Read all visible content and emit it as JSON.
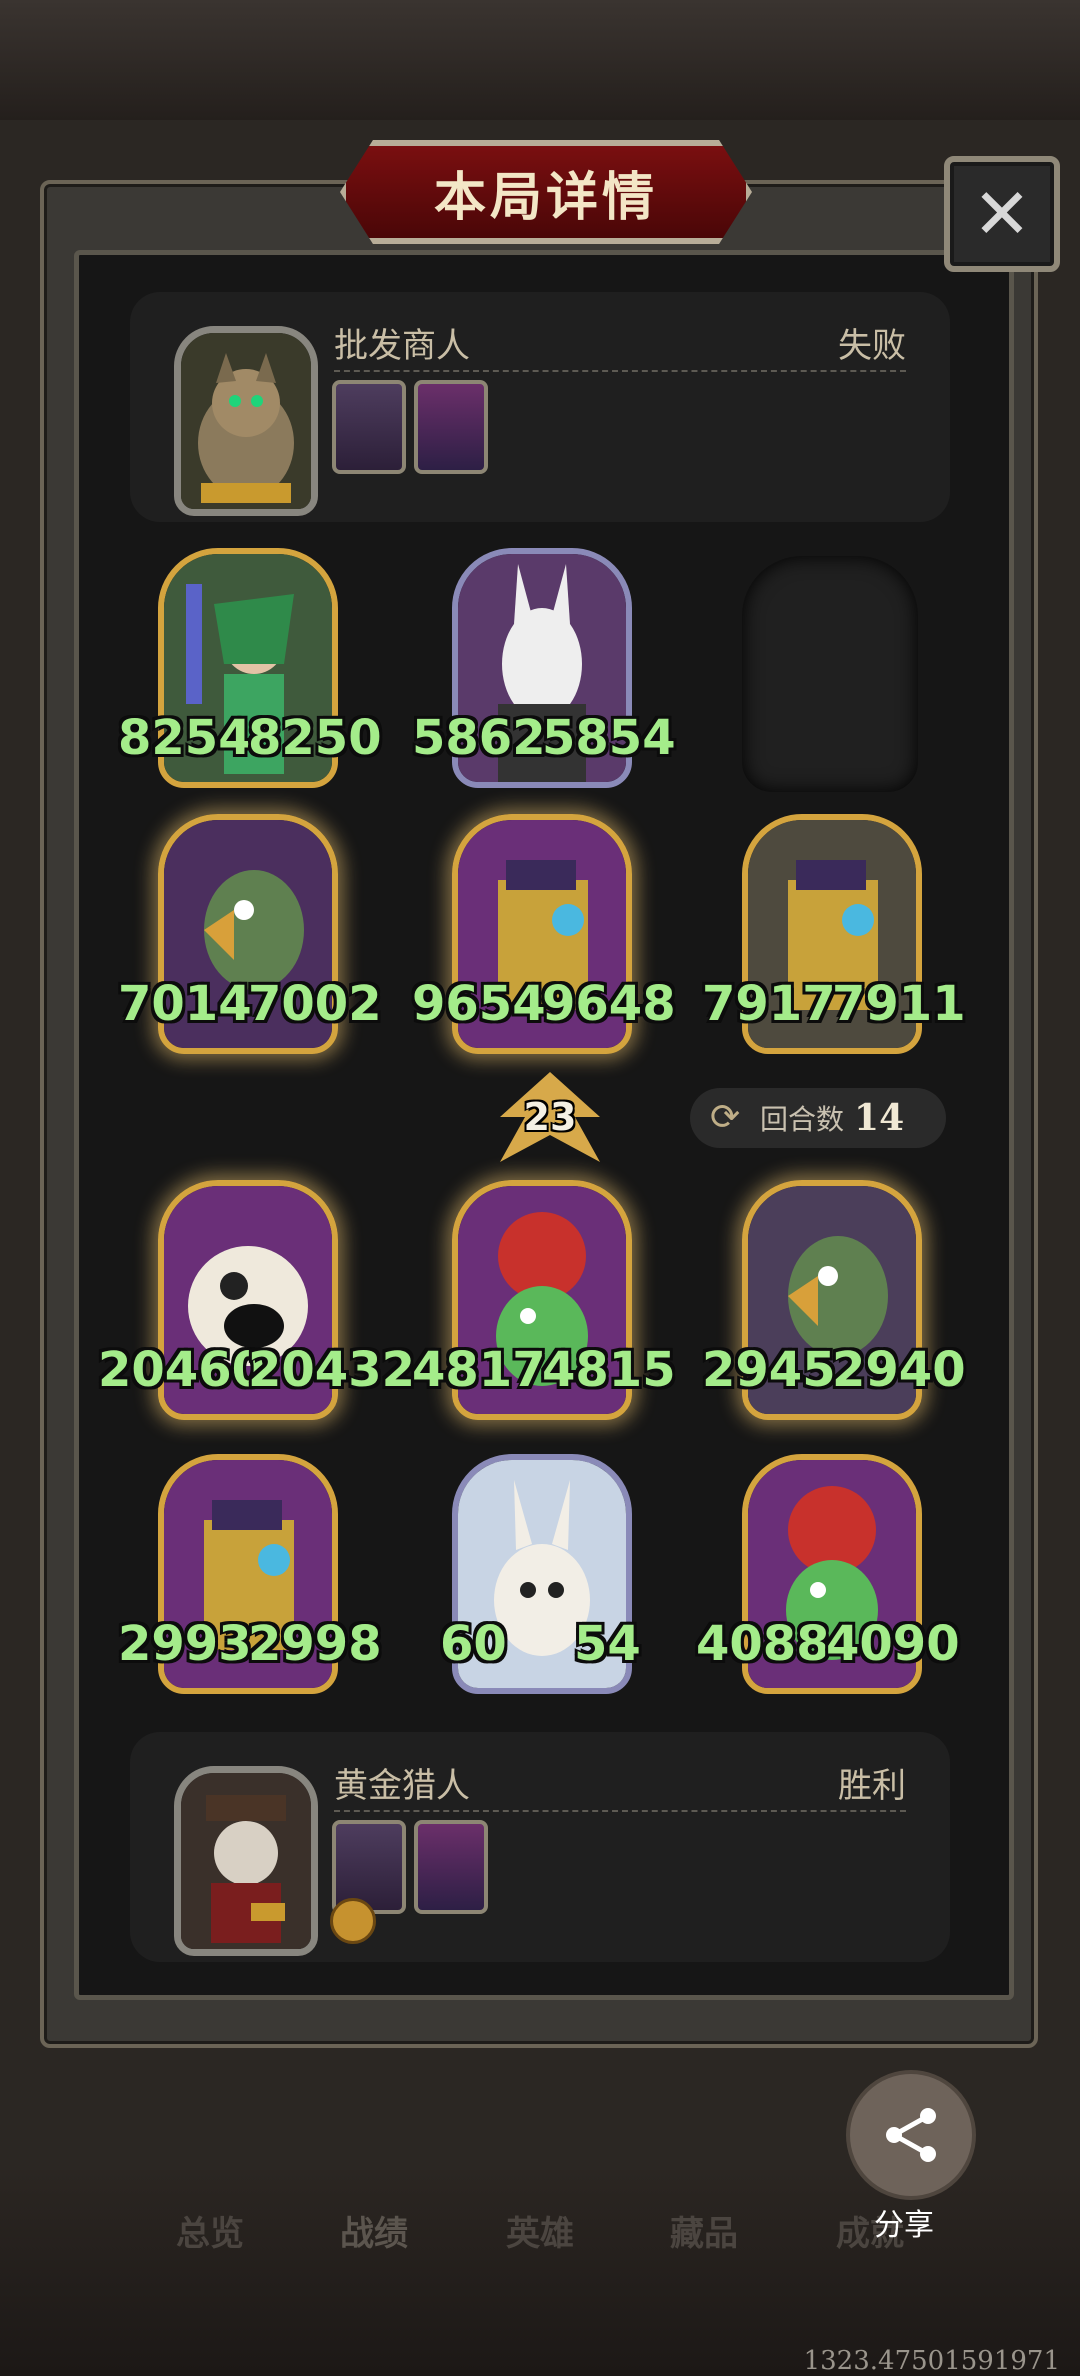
{
  "title": "本局详情",
  "close_icon": "close-icon",
  "top_player": {
    "name": "批发商人",
    "result": "失败"
  },
  "bottom_player": {
    "name": "黄金猎人",
    "result": "胜利"
  },
  "units_top": [
    {
      "atk": "8254",
      "hp": "8250"
    },
    {
      "atk": "5862",
      "hp": "5854"
    },
    {
      "atk": "7014",
      "hp": "7002"
    },
    {
      "atk": "9654",
      "hp": "9648"
    },
    {
      "atk": "7917",
      "hp": "7911"
    }
  ],
  "units_bottom": [
    {
      "atk": "20460",
      "hp": "20432"
    },
    {
      "atk": "4817",
      "hp": "4815"
    },
    {
      "atk": "2945",
      "hp": "2940"
    },
    {
      "atk": "2993",
      "hp": "2998"
    },
    {
      "atk": "60",
      "hp": "54"
    },
    {
      "atk": "4088",
      "hp": "4090"
    }
  ],
  "tier": "23",
  "turns": {
    "label": "回合数",
    "value": "14"
  },
  "share_label": "分享",
  "nav": [
    "总览",
    "战绩",
    "英雄",
    "藏品",
    "成就"
  ],
  "footer_number": "1323.47501591971",
  "colors": {
    "stat_green": "#a4ec8a",
    "gold_frame": "#d4a43e",
    "title_red": "#7a0f10"
  }
}
